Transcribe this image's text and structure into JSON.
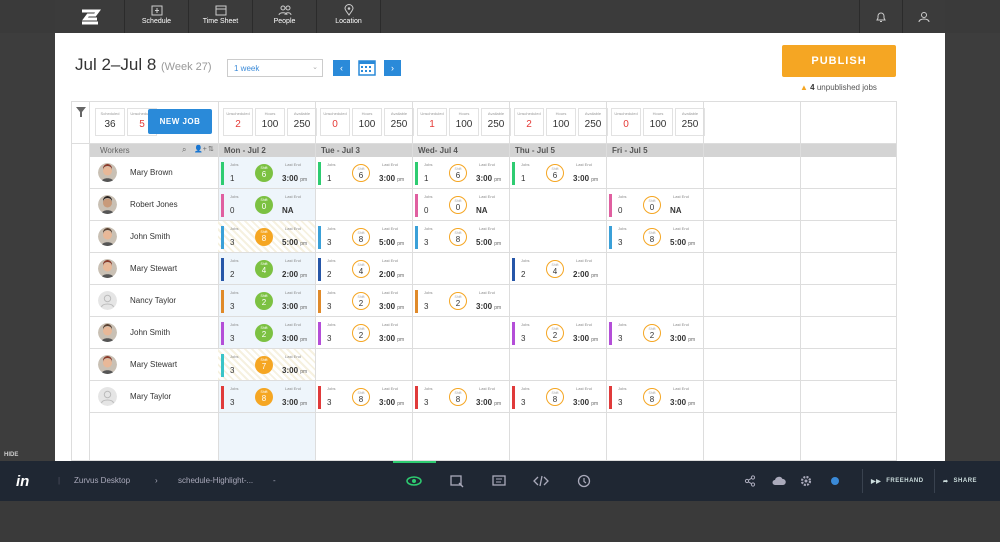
{
  "nav": {
    "items": [
      {
        "label": "Schedule",
        "icon": "schedule-icon"
      },
      {
        "label": "Time Sheet",
        "icon": "calendar-icon"
      },
      {
        "label": "People",
        "icon": "people-icon"
      },
      {
        "label": "Location",
        "icon": "location-pin-icon"
      }
    ]
  },
  "header": {
    "date_range": "Jul 2–Jul 8",
    "week": "(Week 27)",
    "week_select": "1 week",
    "prev": "‹",
    "next": "›",
    "publish": "PUBLISH",
    "unpublished_count": "4",
    "unpublished_text": "unpublished jobs"
  },
  "stats": {
    "summary": {
      "unscheduled_label": "Scheduled",
      "unscheduled": "36",
      "unsch_label": "Unscheduled",
      "unsch": "5",
      "newjob": "NEW JOB"
    },
    "days": [
      {
        "a": "2",
        "b": "100",
        "c": "250"
      },
      {
        "a": "0",
        "b": "100",
        "c": "250"
      },
      {
        "a": "1",
        "b": "100",
        "c": "250"
      },
      {
        "a": "2",
        "b": "100",
        "c": "250"
      },
      {
        "a": "0",
        "b": "100",
        "c": "250"
      }
    ],
    "labels": {
      "a": "Unscheduled",
      "b": "Hours",
      "c": "Available"
    }
  },
  "columns": {
    "workers": "Workers",
    "days": [
      "Mon - Jul 2",
      "Tue - Jul 3",
      "Wed- Jul 4",
      "Thu - Jul 5",
      "Fri - Jul 5"
    ]
  },
  "cell_labels": {
    "jobs": "Jobs",
    "last": "Last End",
    "shift": "Shift",
    "pm": "pm"
  },
  "rows": [
    {
      "name": "Mary Brown",
      "cells": [
        {
          "bar": "#2ecc71",
          "jobs": "1",
          "n": "6",
          "fill": "#7cc142",
          "last": "3:00",
          "pm": true
        },
        {
          "bar": "#2ecc71",
          "jobs": "1",
          "n": "6",
          "last": "3:00",
          "pm": true
        },
        {
          "bar": "#2ecc71",
          "jobs": "1",
          "n": "6",
          "last": "3:00",
          "pm": true
        },
        {
          "bar": "#2ecc71",
          "jobs": "1",
          "n": "6",
          "last": "3:00",
          "pm": true
        },
        null
      ]
    },
    {
      "name": "Robert Jones",
      "cells": [
        {
          "bar": "#e05fa0",
          "jobs": "0",
          "n": "0",
          "fill": "#7cc142",
          "last": "NA"
        },
        null,
        {
          "bar": "#e05fa0",
          "jobs": "0",
          "n": "0",
          "last": "NA"
        },
        null,
        {
          "bar": "#e05fa0",
          "jobs": "0",
          "n": "0",
          "last": "NA"
        }
      ]
    },
    {
      "name": "John Smith",
      "cells": [
        {
          "bar": "#3aa0d8",
          "jobs": "3",
          "n": "8",
          "fill": "#f5a623",
          "hatch": true,
          "last": "5:00",
          "pm": true
        },
        {
          "bar": "#3aa0d8",
          "jobs": "3",
          "n": "8",
          "last": "5:00",
          "pm": true
        },
        {
          "bar": "#3aa0d8",
          "jobs": "3",
          "n": "8",
          "last": "5:00",
          "pm": true
        },
        null,
        {
          "bar": "#3aa0d8",
          "jobs": "3",
          "n": "8",
          "last": "5:00",
          "pm": true
        }
      ]
    },
    {
      "name": "Mary Stewart",
      "cells": [
        {
          "bar": "#2656a8",
          "jobs": "2",
          "n": "4",
          "fill": "#7cc142",
          "last": "2:00",
          "pm": true
        },
        {
          "bar": "#2656a8",
          "jobs": "2",
          "n": "4",
          "last": "2:00",
          "pm": true
        },
        null,
        {
          "bar": "#2656a8",
          "jobs": "2",
          "n": "4",
          "last": "2:00",
          "pm": true
        },
        null
      ]
    },
    {
      "name": "Nancy Taylor",
      "cells": [
        {
          "bar": "#e08a2a",
          "jobs": "3",
          "n": "2",
          "fill": "#7cc142",
          "last": "3:00",
          "pm": true
        },
        {
          "bar": "#e08a2a",
          "jobs": "3",
          "n": "2",
          "last": "3:00",
          "pm": true
        },
        {
          "bar": "#e08a2a",
          "jobs": "3",
          "n": "2",
          "last": "3:00",
          "pm": true
        },
        null,
        null
      ]
    },
    {
      "name": "John Smith",
      "cells": [
        {
          "bar": "#b44ed8",
          "jobs": "3",
          "n": "2",
          "fill": "#7cc142",
          "last": "3:00",
          "pm": true
        },
        {
          "bar": "#b44ed8",
          "jobs": "3",
          "n": "2",
          "last": "3:00",
          "pm": true
        },
        null,
        {
          "bar": "#b44ed8",
          "jobs": "3",
          "n": "2",
          "last": "3:00",
          "pm": true
        },
        {
          "bar": "#b44ed8",
          "jobs": "3",
          "n": "2",
          "last": "3:00",
          "pm": true
        }
      ]
    },
    {
      "name": "Mary Stewart",
      "cells": [
        {
          "bar": "#3ac4c8",
          "jobs": "3",
          "n": "7",
          "fill": "#f5a623",
          "hatch": true,
          "last": "3:00",
          "pm": true
        },
        null,
        null,
        null,
        null
      ]
    },
    {
      "name": "Mary Taylor",
      "cells": [
        {
          "bar": "#e03a3a",
          "jobs": "3",
          "n": "8",
          "fill": "#f5a623",
          "last": "3:00",
          "pm": true
        },
        {
          "bar": "#e03a3a",
          "jobs": "3",
          "n": "8",
          "last": "3:00",
          "pm": true
        },
        {
          "bar": "#e03a3a",
          "jobs": "3",
          "n": "8",
          "last": "3:00",
          "pm": true
        },
        {
          "bar": "#e03a3a",
          "jobs": "3",
          "n": "8",
          "last": "3:00",
          "pm": true
        },
        {
          "bar": "#e03a3a",
          "jobs": "3",
          "n": "8",
          "last": "3:00",
          "pm": true
        }
      ]
    }
  ],
  "avatars": [
    "woman",
    "man-dark",
    "man",
    "woman",
    "placeholder",
    "man",
    "woman",
    "placeholder"
  ],
  "bottom": {
    "hide": "HIDE",
    "logo": "in",
    "project": "Zurvus Desktop",
    "screen": "schedule-Highlight-...",
    "dash": "-",
    "freehand": "FREEHAND",
    "share": "SHARE"
  }
}
